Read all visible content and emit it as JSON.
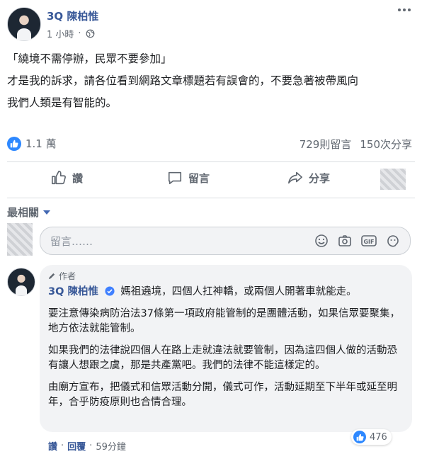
{
  "post": {
    "author": "3Q 陳柏惟",
    "time": "1 小時",
    "line1": "「繞境不需停辦，民眾不要參加」",
    "line2": "才是我的訴求，請各位看到網路文章標題若有誤會的，不要急著被帶風向",
    "line3": "我們人類是有智能的。"
  },
  "stats": {
    "reactions": "1.1 萬",
    "comments": "729則留言",
    "shares": "150次分享"
  },
  "actions": {
    "like": "讚",
    "comment": "留言",
    "share": "分享"
  },
  "sort_label": "最相關",
  "comment_box": {
    "placeholder": "留言……"
  },
  "top_comment": {
    "badge": "作者",
    "author": "3Q 陳柏惟",
    "p1": "媽祖遶境，四個人扛神轎，或兩個人開著車就能走。",
    "p2": "要注意傳染病防治法37條第一項政府能管制的是團體活動，如果信眾要聚集，地方依法就能管制。",
    "p3": "如果我們的法律說四個人在路上走就違法就要管制，因為這四個人做的活動恐有讓人想跟之虞，那是共產黨吧。我們的法律不能這樣定的。",
    "p4": "由廟方宣布，把儀式和信眾活動分開，儀式可作，活動延期至下半年或延至明年，合乎防疫原則也合情合理。",
    "likes": "476",
    "like_action": "讚",
    "reply_action": "回覆",
    "time": "59分鐘"
  }
}
